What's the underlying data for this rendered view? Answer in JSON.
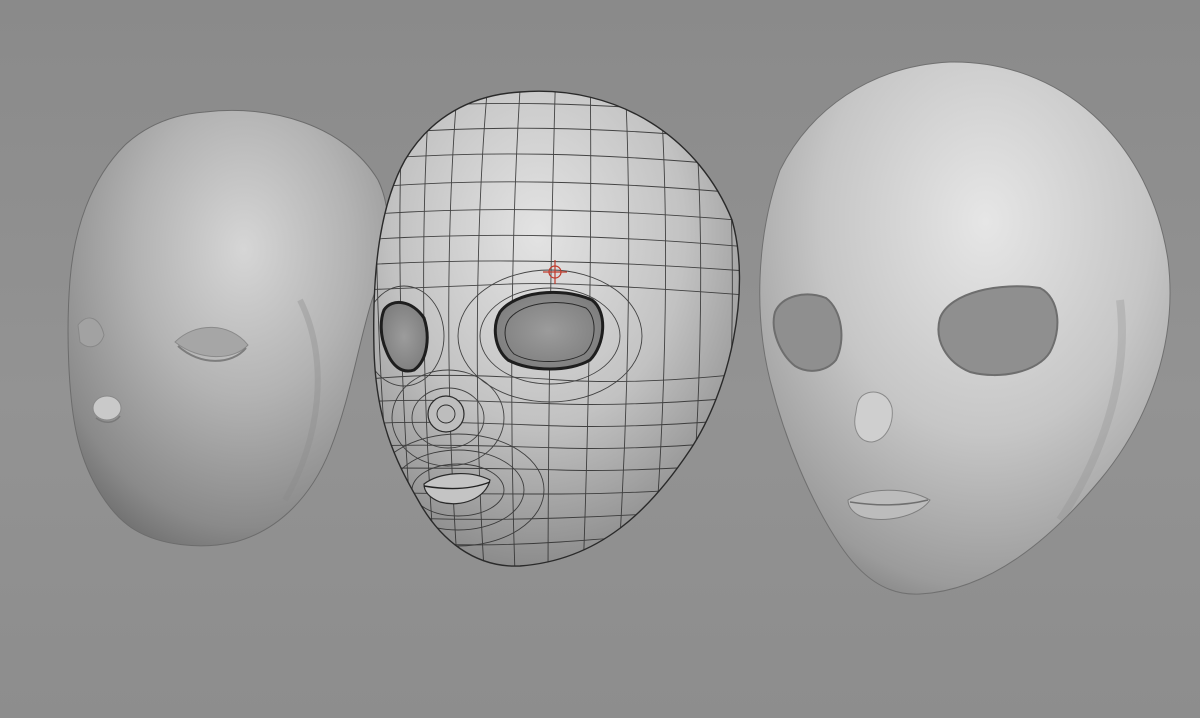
{
  "viewport": {
    "background": "#8e8e8e",
    "models": [
      {
        "id": "head-left",
        "label": "",
        "display": "smooth-shaded"
      },
      {
        "id": "head-center",
        "label": "",
        "display": "wireframe-on-shaded"
      },
      {
        "id": "head-right",
        "label": "",
        "display": "smooth-shaded"
      }
    ],
    "pivot_marker_color": "#c0392b"
  }
}
